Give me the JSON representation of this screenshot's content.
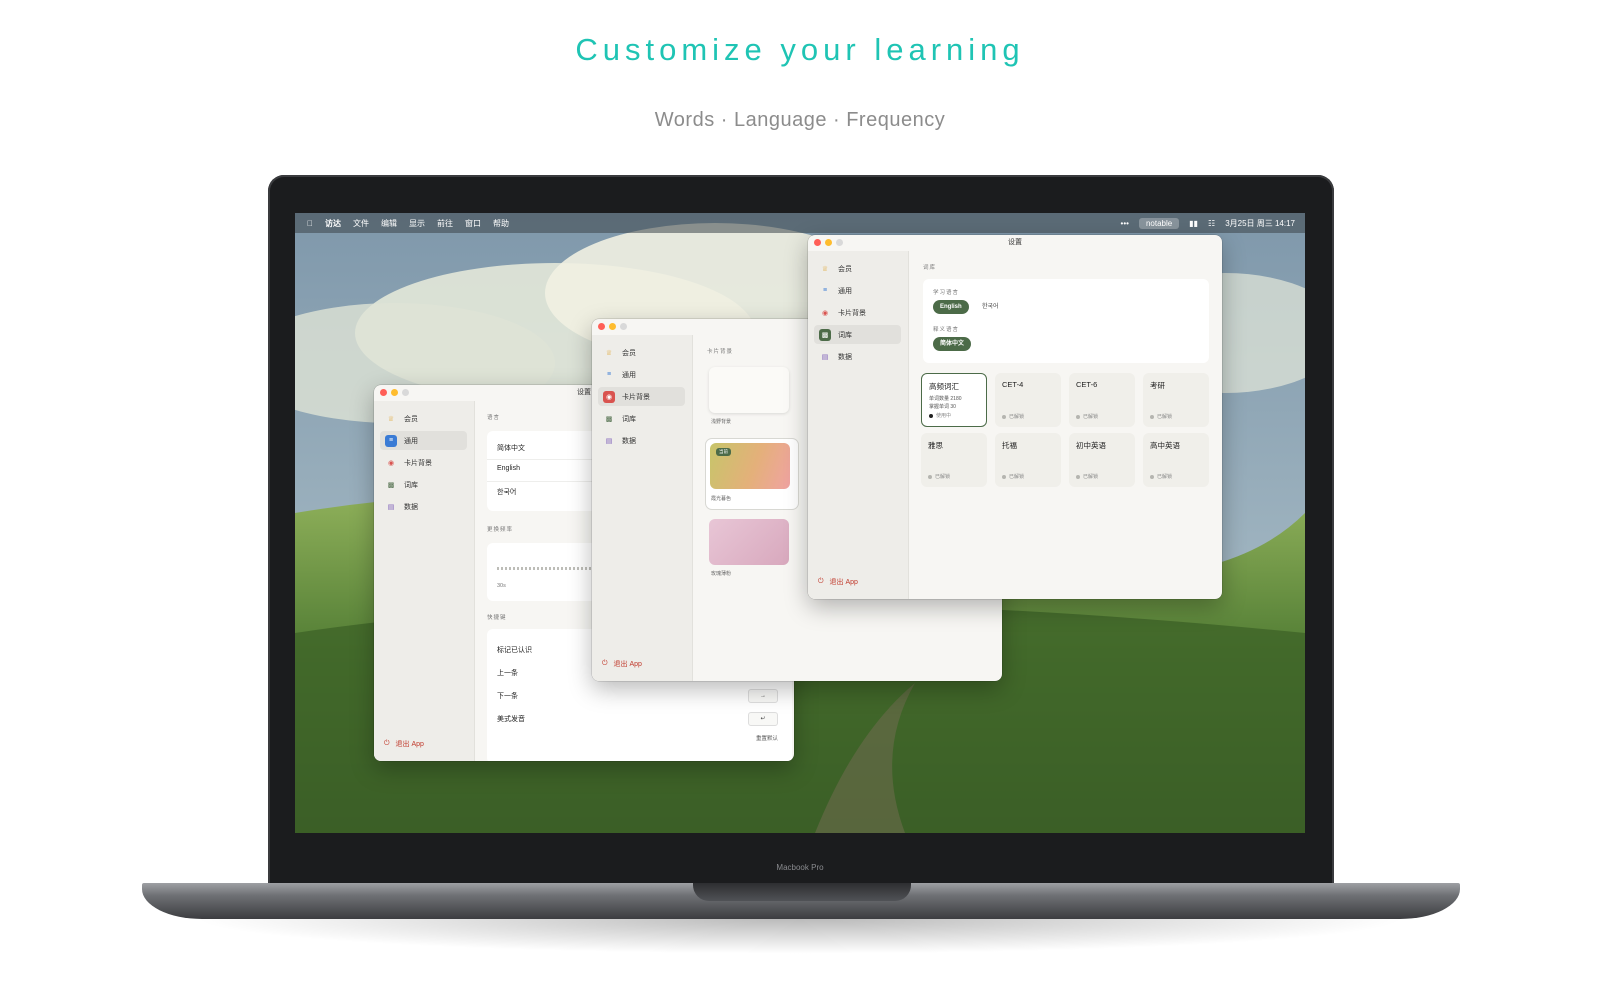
{
  "hero": {
    "title": "Customize your learning",
    "subtitle": "Words · Language · Frequency"
  },
  "device": {
    "model": "Macbook Pro"
  },
  "menubar": {
    "apple_icon": "apple-logo",
    "items": [
      "访达",
      "文件",
      "编辑",
      "显示",
      "前往",
      "窗口",
      "帮助"
    ],
    "right": {
      "dots": "•••",
      "app_pill": "notable",
      "datetime": "3月25日 周三 14:17"
    }
  },
  "sidebar": {
    "items": [
      {
        "label": "会员",
        "icon": "crown-icon"
      },
      {
        "label": "通用",
        "icon": "list-icon"
      },
      {
        "label": "卡片背景",
        "icon": "palette-icon"
      },
      {
        "label": "词库",
        "icon": "chart-icon"
      },
      {
        "label": "数据",
        "icon": "database-icon"
      }
    ],
    "logout": "退出 App"
  },
  "window_general": {
    "title": "设置",
    "language_label": "语言",
    "languages": [
      "简体中文",
      "English",
      "한국어"
    ],
    "frequency_label": "更换频率",
    "frequency_value": "30s",
    "shortcut_label": "快捷键",
    "shortcuts": [
      {
        "label": "标记已认识",
        "key": ""
      },
      {
        "label": "上一条",
        "key": ""
      },
      {
        "label": "下一条",
        "key": "→"
      },
      {
        "label": "美式发音",
        "key": "↵"
      }
    ],
    "reset": "重置默认"
  },
  "window_cards": {
    "title": "设置",
    "section_label": "卡片背景",
    "backgrounds": [
      {
        "caption": "浅野背景"
      },
      {
        "caption": "霞光暮色",
        "badge": "当前"
      },
      {
        "caption": "玫瑰薄粉"
      }
    ]
  },
  "window_lexicon": {
    "title": "设置",
    "section_label": "词库",
    "study_language_label": "学习语言",
    "study_languages": [
      "English",
      "한국어"
    ],
    "explain_language_label": "释义语言",
    "explain_languages": [
      "简体中文"
    ],
    "lexicons": [
      {
        "name": "高频词汇",
        "meta1": "单词数量 2180",
        "meta2": "掌握单词 30",
        "status": "使用中",
        "active": true
      },
      {
        "name": "CET-4",
        "status": "已解锁"
      },
      {
        "name": "CET-6",
        "status": "已解锁"
      },
      {
        "name": "考研",
        "status": "已解锁"
      },
      {
        "name": "雅思",
        "status": "已解锁"
      },
      {
        "name": "托福",
        "status": "已解锁"
      },
      {
        "name": "初中英语",
        "status": "已解锁"
      },
      {
        "name": "高中英语",
        "status": "已解锁"
      }
    ]
  },
  "colors": {
    "accent": "#1fc4b4",
    "brand_green": "#4c6b48",
    "logout_red": "#c0392b"
  }
}
